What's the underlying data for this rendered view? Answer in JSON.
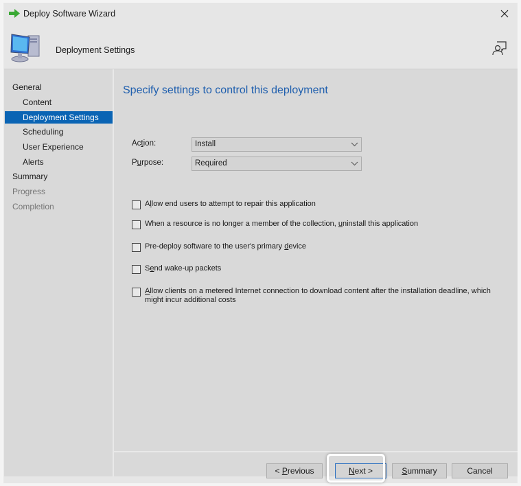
{
  "window": {
    "title": "Deploy Software Wizard",
    "close_icon": "close-icon",
    "title_icon": "green-arrow-icon"
  },
  "header": {
    "title": "Deployment Settings",
    "icon": "computer-icon",
    "feedback_icon": "feedback-person-icon"
  },
  "sidebar": {
    "items": [
      {
        "label": "General",
        "level": 0,
        "state": "normal"
      },
      {
        "label": "Content",
        "level": 1,
        "state": "normal"
      },
      {
        "label": "Deployment Settings",
        "level": 1,
        "state": "active"
      },
      {
        "label": "Scheduling",
        "level": 1,
        "state": "normal"
      },
      {
        "label": "User Experience",
        "level": 1,
        "state": "normal"
      },
      {
        "label": "Alerts",
        "level": 1,
        "state": "normal"
      },
      {
        "label": "Summary",
        "level": 0,
        "state": "normal"
      },
      {
        "label": "Progress",
        "level": 0,
        "state": "disabled"
      },
      {
        "label": "Completion",
        "level": 0,
        "state": "disabled"
      }
    ]
  },
  "main": {
    "heading": "Specify settings to control this deployment",
    "action": {
      "label_pre": "Ac",
      "label_u": "t",
      "label_post": "ion:",
      "value": "Install"
    },
    "purpose": {
      "label_pre": "P",
      "label_u": "u",
      "label_post": "rpose:",
      "value": "Required"
    },
    "checkboxes": [
      {
        "pre": "A",
        "u": "l",
        "post": "low end users to attempt to repair this application",
        "checked": false
      },
      {
        "pre": "When a resource is no longer a member of the collection, ",
        "u": "u",
        "post": "ninstall this application",
        "checked": false
      },
      {
        "pre": "Pre-deploy software to the user's primary ",
        "u": "d",
        "post": "evice",
        "checked": false
      },
      {
        "pre": "S",
        "u": "e",
        "post": "nd wake-up packets",
        "checked": false
      },
      {
        "pre": "",
        "u": "A",
        "post": "llow clients on a metered Internet connection to download content after the installation deadline, which might incur additional costs",
        "checked": false
      }
    ]
  },
  "footer": {
    "previous": {
      "pre": "< ",
      "u": "P",
      "post": "revious"
    },
    "next": {
      "pre": "",
      "u": "N",
      "post": "ext >"
    },
    "summary": {
      "pre": "",
      "u": "S",
      "post": "ummary"
    },
    "cancel": {
      "label": "Cancel"
    }
  },
  "colors": {
    "accent": "#0a64b4",
    "heading": "#1f5fae"
  }
}
